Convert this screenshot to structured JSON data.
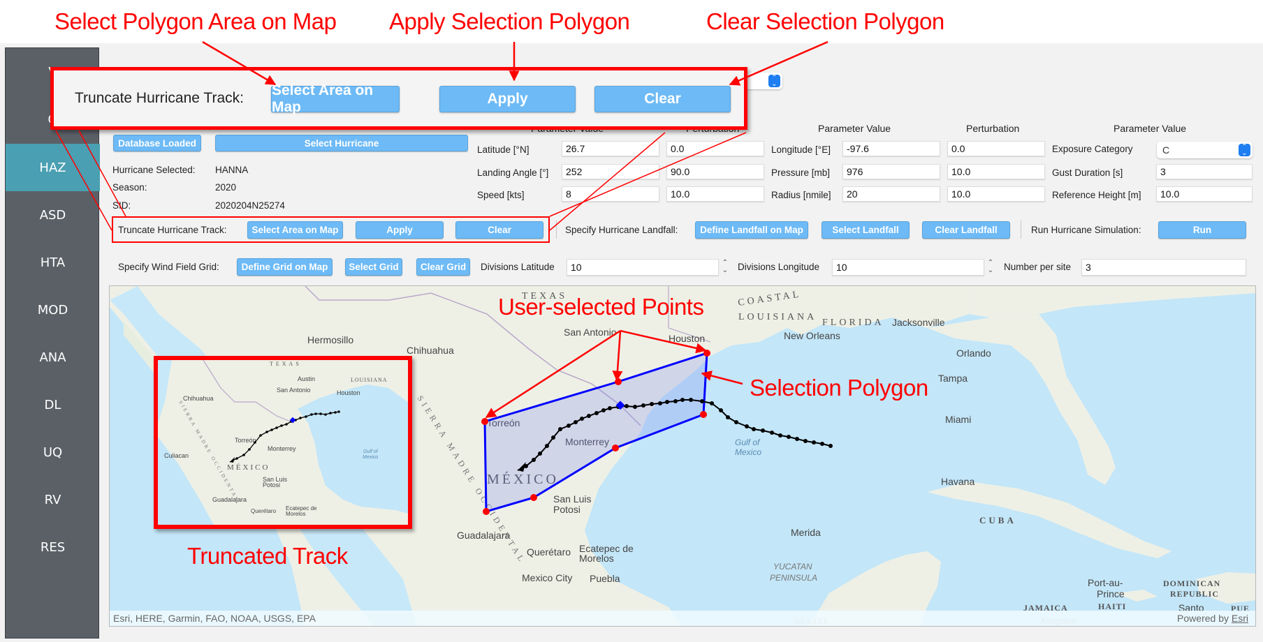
{
  "annotations": {
    "select_polygon": "Select Polygon Area on Map",
    "apply_polygon": "Apply Selection Polygon",
    "clear_polygon": "Clear Selection Polygon",
    "user_points": "User-selected Points",
    "selection_polygon": "Selection Polygon",
    "truncated_track": "Truncated Track",
    "color": "#ff0000"
  },
  "popup": {
    "label": "Truncate Hurricane Track:",
    "select_area": "Select Area on Map",
    "apply": "Apply",
    "clear": "Clear"
  },
  "sidebar": {
    "items": [
      {
        "label": "VEH",
        "partial": "V"
      },
      {
        "label": "GI",
        "partial": "G"
      },
      {
        "label": "HAZ",
        "active": true
      },
      {
        "label": "ASD"
      },
      {
        "label": "HTA"
      },
      {
        "label": "MOD"
      },
      {
        "label": "ANA"
      },
      {
        "label": "DL"
      },
      {
        "label": "UQ"
      },
      {
        "label": "RV"
      },
      {
        "label": "RES"
      }
    ],
    "active_color": "#4a9fb2",
    "bg_color": "#5b6067"
  },
  "hurricane": {
    "database_button": "Database Loaded",
    "select_button": "Select Hurricane",
    "selected_label": "Hurricane Selected:",
    "selected_value": "HANNA",
    "season_label": "Season:",
    "season_value": "2020",
    "sid_label": "SID:",
    "sid_value": "2020204N25274"
  },
  "params": {
    "col_headers": [
      "Parameter Value",
      "Perturbation",
      "Parameter Value",
      "Perturbation",
      "Parameter Value"
    ],
    "group1": [
      {
        "label": "Latitude [°N]",
        "value": "26.7",
        "perturbation": "0.0"
      },
      {
        "label": "Landing Angle [°]",
        "value": "252",
        "perturbation": "90.0"
      },
      {
        "label": "Speed [kts]",
        "value": "8",
        "perturbation": "10.0"
      }
    ],
    "group2": [
      {
        "label": "Longitude [°E]",
        "value": "-97.6",
        "perturbation": "0.0"
      },
      {
        "label": "Pressure [mb]",
        "value": "976",
        "perturbation": "10.0"
      },
      {
        "label": "Radius [nmile]",
        "value": "20",
        "perturbation": "10.0"
      }
    ],
    "group3": [
      {
        "label": "Exposure Category",
        "value": "C"
      },
      {
        "label": "Gust Duration [s]",
        "value": "3"
      },
      {
        "label": "Reference Height [m]",
        "value": "10.0"
      }
    ]
  },
  "truncate": {
    "label": "Truncate Hurricane Track:",
    "select_area": "Select Area on Map",
    "apply": "Apply",
    "clear": "Clear"
  },
  "landfall": {
    "label": "Specify Hurricane Landfall:",
    "define": "Define Landfall on Map",
    "select": "Select Landfall",
    "clear": "Clear Landfall"
  },
  "run": {
    "label": "Run Hurricane Simulation:",
    "button": "Run"
  },
  "grid": {
    "label": "Specify Wind Field Grid:",
    "define": "Define Grid on Map",
    "select": "Select Grid",
    "clear": "Clear Grid",
    "div_lat_label": "Divisions Latitude",
    "div_lat_value": "10",
    "div_lon_label": "Divisions Longitude",
    "div_lon_value": "10",
    "num_per_site_label": "Number per site",
    "num_per_site_value": "3"
  },
  "map": {
    "attribution_left": "Esri, HERE, Garmin, FAO, NOAA, USGS, EPA",
    "attribution_right_prefix": "Powered by ",
    "attribution_right_link": "Esri",
    "labels": {
      "texas": "TEXAS",
      "coastal": "COASTAL",
      "louisiana": "LOUISIANA",
      "florida": "FLORIDA",
      "jacksonville": "Jacksonville",
      "hermosillo": "Hermosillo",
      "chihuahua": "Chihuahua",
      "san_antonio": "San Antonio",
      "houston": "Houston",
      "new_orleans": "New Orleans",
      "orlando": "Orlando",
      "tampa": "Tampa",
      "miami": "Miami",
      "torreon": "Torreón",
      "monterrey": "Monterrey",
      "mexico": "MÉXICO",
      "san_luis_potosi_1": "San Luis",
      "san_luis_potosi_2": "Potosi",
      "gulf_1": "Gulf of",
      "gulf_2": "Mexico",
      "havana": "Havana",
      "cuba": "CUBA",
      "guadalajara": "Guadalajara",
      "queretaro": "Querétaro",
      "ecatepec_1": "Ecatepec de",
      "ecatepec_2": "Morelos",
      "mexico_city": "Mexico City",
      "puebla": "Puebla",
      "merida": "Merida",
      "yucatan_1": "YUCATAN",
      "yucatan_2": "PENINSULA",
      "port_au_prince_1": "Port-au-",
      "port_au_prince_2": "Prince",
      "haiti": "HAITI",
      "dominican_1": "DOMINICAN",
      "dominican_2": "REPUBLIC",
      "santo": "Santo",
      "jamaica": "JAMAICA",
      "kingston": "Kingston",
      "belize": "BELIZE",
      "pue": "PUE",
      "sierra_madre_main": "SIERRA MADRE OCCIDENTAL"
    },
    "inset_labels": {
      "texas": "TEXAS",
      "austin": "Austin",
      "louisiana": "LOUISIANA",
      "san_antonio": "San Antonio",
      "houston": "Houston",
      "chihuahua": "Chihuahua",
      "torreon": "Torreón",
      "monterrey": "Monterrey",
      "culiacan": "Culiacan",
      "mexico": "MÉXICO",
      "san_luis_1": "San Luis",
      "san_luis_2": "Potosi",
      "gulf_1": "Gulf of",
      "gulf_2": "Mexico",
      "guadalajara": "Guadalajara",
      "queretaro": "Querétaro",
      "ecatepec_1": "Ecatepec de",
      "ecatepec_2": "Morelos",
      "sierra": "SIERRA MADRE OCCIDENTAL"
    },
    "polygon_color": "#0000ff",
    "point_color": "#ff0000",
    "track_color": "#000000"
  }
}
